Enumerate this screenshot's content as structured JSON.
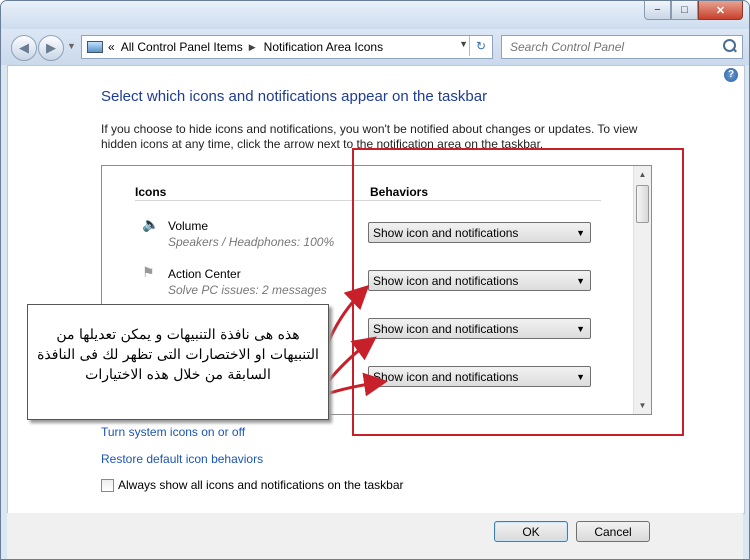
{
  "window": {
    "caption_min": "−",
    "caption_max": "□",
    "caption_close": "✕"
  },
  "navigation": {
    "back_icon": "◀",
    "forward_icon": "▶",
    "breadcrumb_overflow": "«",
    "breadcrumb": [
      "All Control Panel Items",
      "Notification Area Icons"
    ],
    "refresh_icon": "↻",
    "search_placeholder": "Search Control Panel"
  },
  "help_icon": "?",
  "main": {
    "heading": "Select which icons and notifications appear on the taskbar",
    "description": "If you choose to hide icons and notifications, you won't be notified about changes or updates. To view hidden icons at any time, click the arrow next to the notification area on the taskbar.",
    "columns": {
      "icons": "Icons",
      "behaviors": "Behaviors"
    },
    "rows": [
      {
        "name": "Volume",
        "detail": "Speakers / Headphones: 100%",
        "icon": "speaker-icon",
        "behavior": "Show icon and notifications"
      },
      {
        "name": "Action Center",
        "detail": "Solve PC issues: 2 messages",
        "icon": "flag-icon",
        "behavior": "Show icon and notifications"
      },
      {
        "behavior": "Show icon and notifications"
      },
      {
        "behavior": "Show icon and notifications"
      }
    ],
    "links": {
      "system_icons": "Turn system icons on or off",
      "restore": "Restore default icon behaviors"
    },
    "always_show": {
      "label": "Always show all icons and notifications on the taskbar",
      "checked": false
    }
  },
  "footer": {
    "ok": "OK",
    "cancel": "Cancel"
  },
  "annotation": {
    "text": "هذه هى نافذة التنبيهات و يمكن تعديلها من التنبيهات او الاختصارات التى تظهر لك فى النافذة السابقة من خلال هذه الاختيارات",
    "highlight_color": "#c8202a"
  }
}
